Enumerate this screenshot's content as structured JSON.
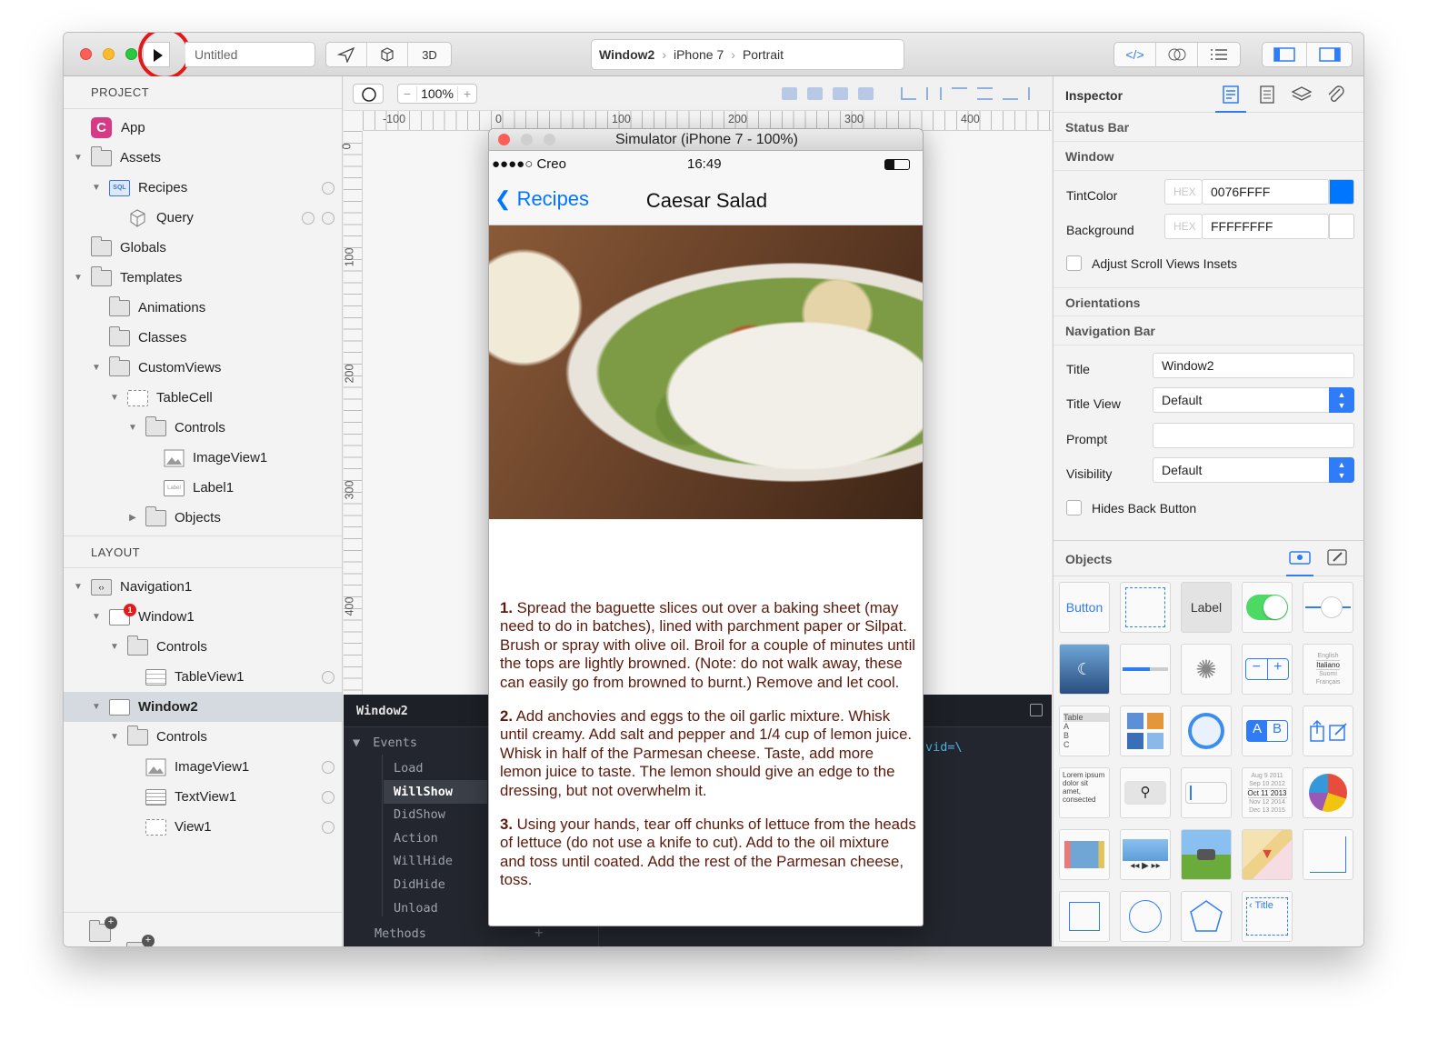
{
  "toolbar": {
    "doc_title": "Untitled",
    "mode_3d": "3D",
    "breadcrumb": [
      "Window2",
      "iPhone 7",
      "Portrait"
    ]
  },
  "project": {
    "header": "PROJECT",
    "items": [
      {
        "label": "App",
        "icon": "app-icon"
      },
      {
        "label": "Assets",
        "icon": "assets-folder-icon"
      },
      {
        "label": "Recipes",
        "icon": "sql-database-icon"
      },
      {
        "label": "Query",
        "icon": "cube-icon"
      },
      {
        "label": "Globals",
        "icon": "folder-icon"
      },
      {
        "label": "Templates",
        "icon": "folder-icon"
      },
      {
        "label": "Animations",
        "icon": "folder-icon"
      },
      {
        "label": "Classes",
        "icon": "folder-icon"
      },
      {
        "label": "CustomViews",
        "icon": "folder-icon"
      },
      {
        "label": "TableCell",
        "icon": "view-icon"
      },
      {
        "label": "Controls",
        "icon": "folder-icon"
      },
      {
        "label": "ImageView1",
        "icon": "image-icon"
      },
      {
        "label": "Label1",
        "icon": "label-icon"
      },
      {
        "label": "Objects",
        "icon": "folder-icon"
      }
    ]
  },
  "layout": {
    "header": "LAYOUT",
    "badge": "1",
    "items": [
      {
        "label": "Navigation1"
      },
      {
        "label": "Window1"
      },
      {
        "label": "Controls"
      },
      {
        "label": "TableView1"
      },
      {
        "label": "Window2"
      },
      {
        "label": "Controls"
      },
      {
        "label": "ImageView1"
      },
      {
        "label": "TextView1"
      },
      {
        "label": "View1"
      }
    ]
  },
  "canvas": {
    "zoom": "100%",
    "hruler": [
      "-100",
      "0",
      "100",
      "200",
      "300",
      "400"
    ],
    "vruler": [
      "0",
      "100",
      "200",
      "300",
      "400"
    ]
  },
  "events": {
    "title": "Window2",
    "section": "Events",
    "items": [
      "Load",
      "WillShow",
      "DidShow",
      "Action",
      "WillHide",
      "DidHide",
      "Unload"
    ],
    "selected": "WillShow",
    "methods": "Methods",
    "code": "vid=\\"
  },
  "simulator": {
    "title": "Simulator (iPhone 7 - 100%)",
    "carrier": "●●●●○ Creo",
    "time": "16:49",
    "back": "Recipes",
    "nav_title": "Caesar Salad",
    "steps": [
      {
        "num": "1.",
        "text": " Spread the baguette slices out over a baking sheet (may need to do in batches), lined with parchment paper or Silpat. Brush or spray with olive oil. Broil for a couple of minutes until the tops are lightly browned. (Note: do not walk away, these can easily go from browned to burnt.) Remove and let cool."
      },
      {
        "num": "2.",
        "text": " Add anchovies and eggs to the oil garlic mixture. Whisk until creamy. Add salt and pepper and 1/4 cup of lemon juice. Whisk in half of the Parmesan cheese. Taste, add more lemon juice to taste. The lemon should give an edge to the dressing, but not overwhelm it."
      },
      {
        "num": "3.",
        "text": " Using your hands, tear off chunks of lettuce from the heads of lettuce (do not use a knife to cut). Add to the oil mixture and toss until coated. Add the rest of the Parmesan cheese, toss."
      }
    ]
  },
  "inspector": {
    "title": "Inspector",
    "status_bar": "Status Bar",
    "window": "Window",
    "tint_label": "TintColor",
    "hex": "HEX",
    "tint_value": "0076FFFF",
    "tint_color": "#0076FF",
    "bg_label": "Background",
    "bg_value": "FFFFFFFF",
    "bg_color": "#FFFFFF",
    "adjust_label": "Adjust Scroll Views Insets",
    "orientations": "Orientations",
    "navbar": "Navigation Bar",
    "title_label": "Title",
    "title_value": "Window2",
    "titleview_label": "Title View",
    "titleview_value": "Default",
    "prompt_label": "Prompt",
    "prompt_value": "",
    "visibility_label": "Visibility",
    "visibility_value": "Default",
    "hides_back_label": "Hides Back Button"
  },
  "objects": {
    "title": "Objects",
    "button": "Button",
    "label": "Label",
    "table_rows": [
      "Table",
      "A",
      "B",
      "C"
    ],
    "lang": [
      "English",
      "Italiano",
      "Suomi",
      "Français"
    ],
    "lorem": "Lorem ipsum dolor sit amet, consected",
    "dates": [
      "Aug 9 2011",
      "Sep 10 2012",
      "Oct 11 2013",
      "Nov 12 2014",
      "Dec 13 2015"
    ],
    "seg": [
      "A",
      "B"
    ],
    "title_item": "Title"
  },
  "colors": {
    "accent": "#2f7cf6",
    "selected_row": "#d5d9e0",
    "recipe_text": "#5c1a0b",
    "red_circle": "#e31919"
  }
}
